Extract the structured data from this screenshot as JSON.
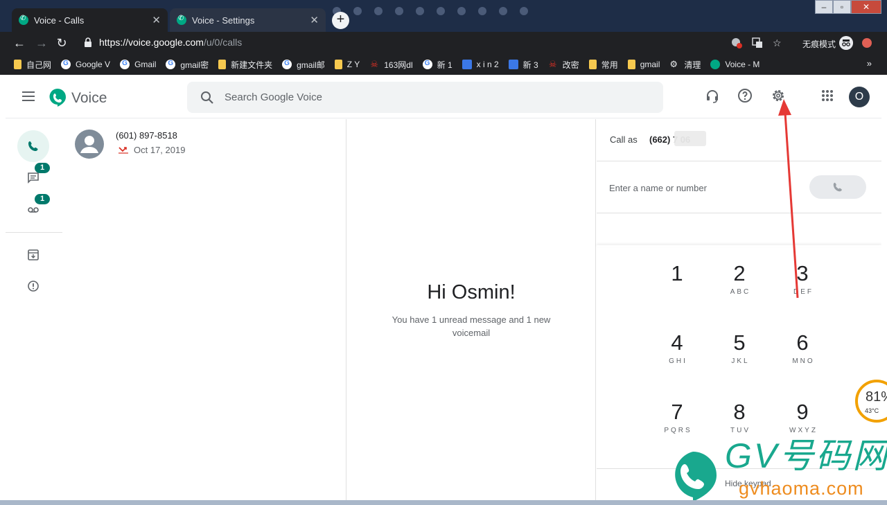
{
  "browser": {
    "tabs": [
      {
        "label": "Voice - Calls",
        "active": true
      },
      {
        "label": "Voice - Settings",
        "active": false
      }
    ],
    "url_host": "https://voice.google.com",
    "url_path": "/u/0/calls",
    "incognito_label": "无痕模式",
    "bookmarks": [
      {
        "label": "自己网",
        "icon": "folder"
      },
      {
        "label": "Google V",
        "icon": "google"
      },
      {
        "label": "Gmail",
        "icon": "google"
      },
      {
        "label": "gmail密",
        "icon": "google"
      },
      {
        "label": "新建文件夹",
        "icon": "folder"
      },
      {
        "label": "gmail邮",
        "icon": "google"
      },
      {
        "label": "Z Y",
        "icon": "folder"
      },
      {
        "label": "163网dl",
        "icon": "skull"
      },
      {
        "label": "新  1",
        "icon": "google"
      },
      {
        "label": "x i n 2",
        "icon": "phone"
      },
      {
        "label": "新    3",
        "icon": "phone"
      },
      {
        "label": "改密",
        "icon": "skull"
      },
      {
        "label": "常用",
        "icon": "folder"
      },
      {
        "label": "gmail",
        "icon": "folder"
      },
      {
        "label": "清理",
        "icon": "gear"
      },
      {
        "label": "Voice - M",
        "icon": "voice"
      }
    ],
    "bookmarks_more": "»"
  },
  "app": {
    "title": "Voice",
    "search_placeholder": "Search Google Voice",
    "avatar_initial": "O",
    "rail": {
      "messages_badge": "1",
      "voicemail_badge": "1"
    },
    "calls": [
      {
        "number": "(601) 897-8518",
        "date": "Oct 17, 2019",
        "status": "missed"
      }
    ],
    "greeting": "Hi Osmin!",
    "greeting_sub": "You have 1 unread message and 1 new voicemail",
    "dialer": {
      "call_as_label": "Call as",
      "call_as_number": "(662) 7      06",
      "input_placeholder": "Enter a name or number",
      "keys": [
        {
          "digit": "1",
          "letters": ""
        },
        {
          "digit": "2",
          "letters": "ABC"
        },
        {
          "digit": "3",
          "letters": "DEF"
        },
        {
          "digit": "4",
          "letters": "GHI"
        },
        {
          "digit": "5",
          "letters": "JKL"
        },
        {
          "digit": "6",
          "letters": "MNO"
        },
        {
          "digit": "7",
          "letters": "PQRS"
        },
        {
          "digit": "8",
          "letters": "TUV"
        },
        {
          "digit": "9",
          "letters": "WXYZ"
        }
      ],
      "hide_keypad": "Hide keypad"
    }
  },
  "overlay": {
    "cpu_percent": "81%",
    "cpu_temp": "43°C",
    "watermark_text": "GV号码网",
    "watermark_url": "gvhaoma.com"
  },
  "colors": {
    "accent": "#00796b",
    "annotation_arrow": "#e53935"
  }
}
